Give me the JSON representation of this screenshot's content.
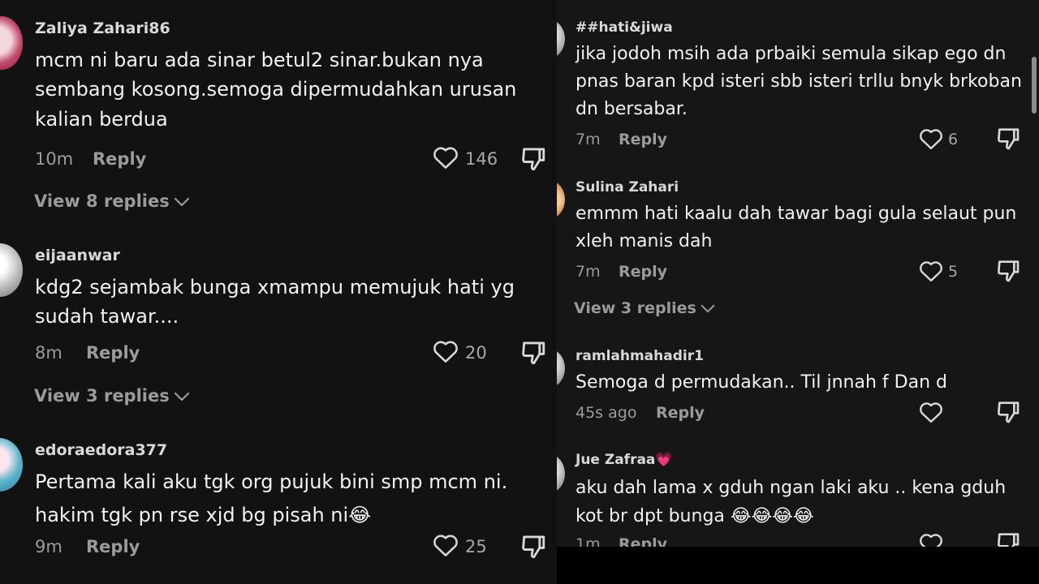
{
  "left": {
    "comments": [
      {
        "username": "Zaliya Zahari86",
        "text": "mcm ni baru ada sinar betul2 sinar.bukan nya sembang kosong.semoga dipermudahkan urusan kalian berdua",
        "time": "10m",
        "reply_label": "Reply",
        "likes": "146",
        "view_replies": "View 8 replies"
      },
      {
        "username": "eijaanwar",
        "text": "kdg2 sejambak bunga xmampu memujuk hati yg sudah tawar....",
        "time": "8m",
        "reply_label": "Reply",
        "likes": "20",
        "view_replies": "View 3 replies"
      },
      {
        "username": "edoraedora377",
        "text": "Pertama kali aku tgk org pujuk bini smp mcm ni. hakim tgk pn rse xjd bg pisah ni😂",
        "time": "9m",
        "reply_label": "Reply",
        "likes": "25"
      }
    ]
  },
  "right": {
    "comments": [
      {
        "username": "##hati&jiwa",
        "text": "jika jodoh msih ada prbaiki semula sikap ego dn pnas baran kpd isteri sbb isteri trllu bnyk brkoban dn bersabar.",
        "time": "7m",
        "reply_label": "Reply",
        "likes": "6"
      },
      {
        "username": "Sulina Zahari",
        "text": "emmm hati kaalu dah tawar bagi gula selaut pun xleh manis dah",
        "time": "7m",
        "reply_label": "Reply",
        "likes": "5",
        "view_replies": "View 3 replies"
      },
      {
        "username": "ramlahmahadir1",
        "text": "Semoga d permudakan.. Til jnnah f Dan d",
        "time": "45s ago",
        "reply_label": "Reply",
        "likes": ""
      },
      {
        "username": "Jue Zafraa💗",
        "text": "aku dah lama x gduh ngan laki aku .. kena gduh kot br dpt bunga 😂😂😂😂",
        "time": "1m",
        "reply_label": "Reply",
        "likes": ""
      }
    ]
  },
  "colors": {
    "background": "#121212",
    "text": "#f1f1f1",
    "muted": "#9b9b9b"
  },
  "icons": [
    "heart-icon",
    "dislike-icon",
    "chevron-down-icon"
  ]
}
